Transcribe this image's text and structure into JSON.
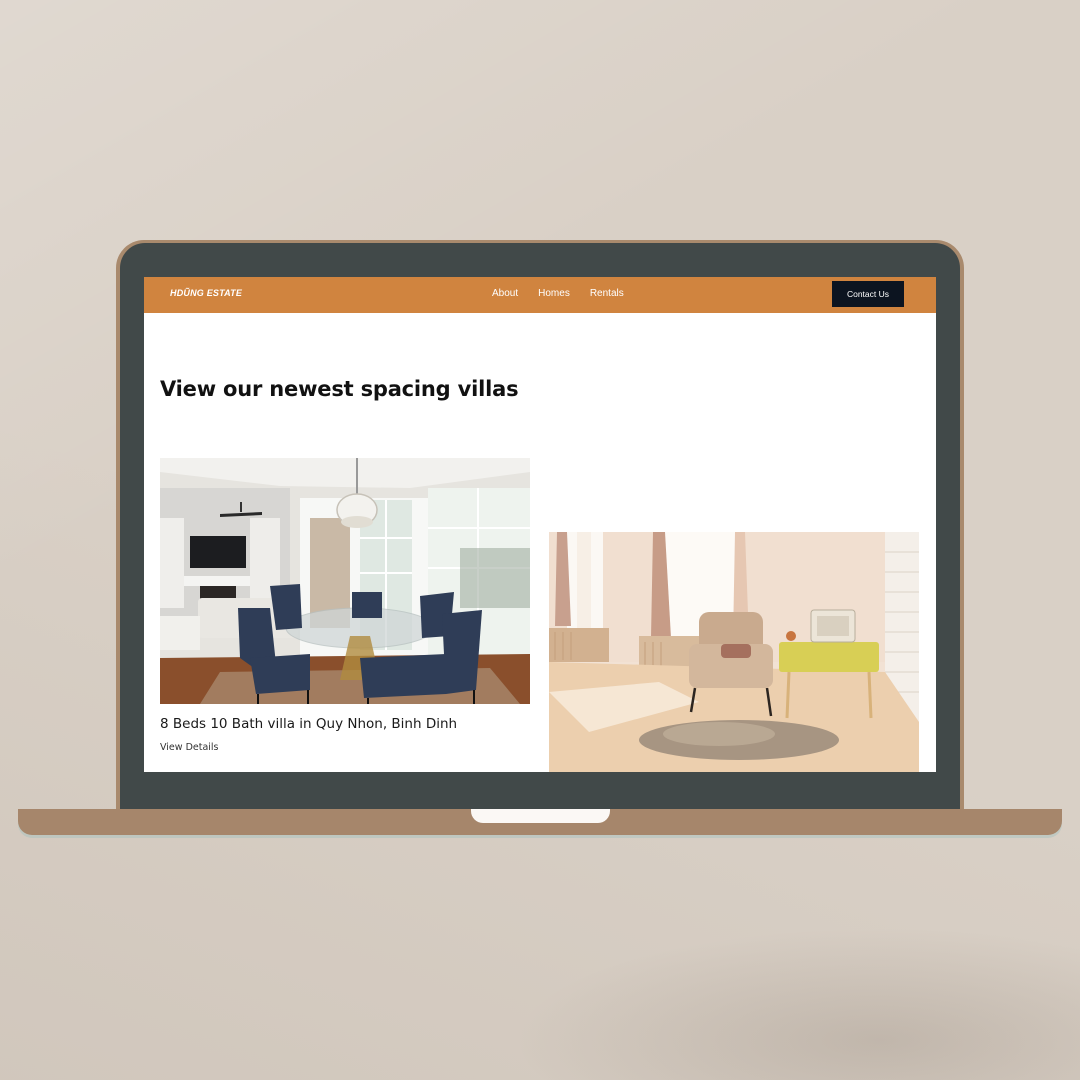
{
  "site": {
    "brand": "HDŨNG ESTATE"
  },
  "nav": {
    "links": [
      "About",
      "Homes",
      "Rentals"
    ],
    "contact_label": "Contact Us"
  },
  "main": {
    "headline": "View our newest spacing villas",
    "listings": [
      {
        "image": "dining-room-photo",
        "title": "8 Beds 10 Bath villa in Quy Nhon, Binh Dinh",
        "link_label": "View Details"
      },
      {
        "image": "living-room-photo"
      }
    ]
  },
  "colors": {
    "background": "#d9d0c6",
    "laptop_body": "#a6866b",
    "bezel": "#414949",
    "navbar": "#d0843f",
    "contact_button": "#0c1420"
  }
}
